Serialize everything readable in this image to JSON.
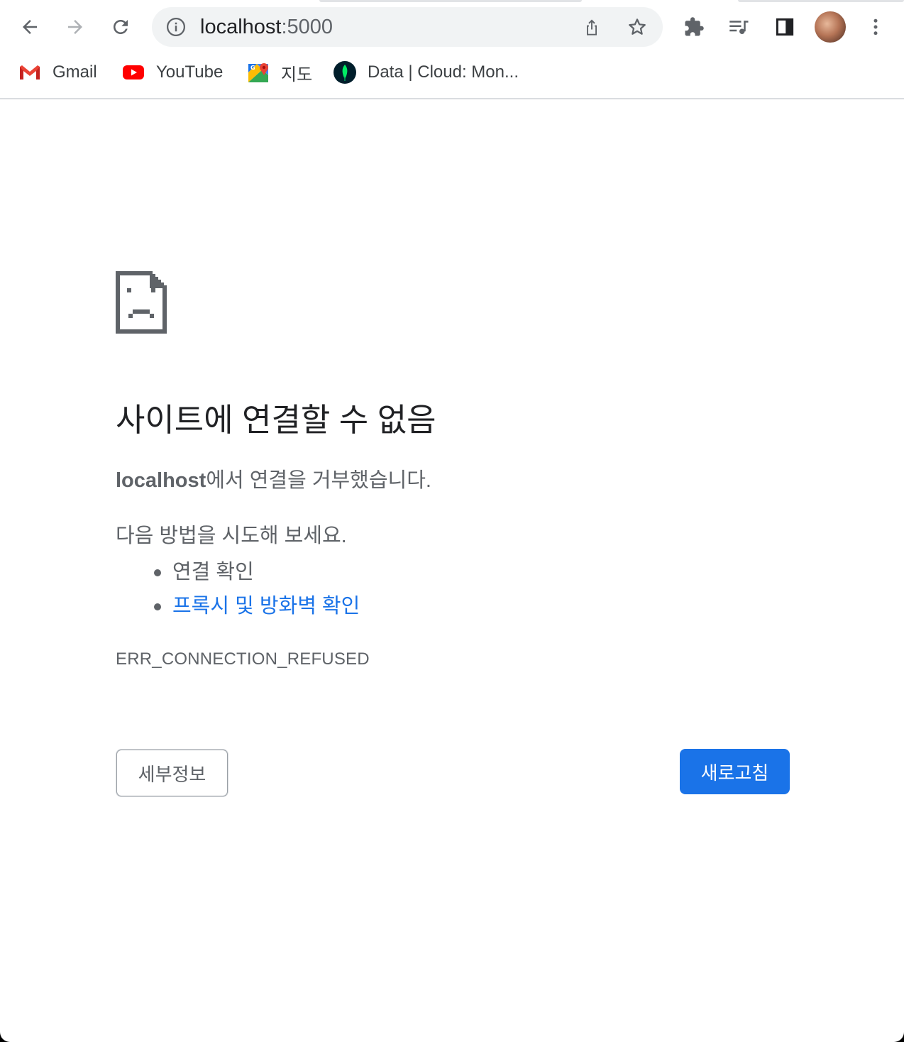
{
  "toolbar": {
    "back_icon": "arrow-left-icon",
    "forward_icon": "arrow-right-icon",
    "reload_icon": "reload-icon",
    "extensions_icon": "puzzle-icon",
    "media_icon": "media-playlist-icon",
    "side_panel_icon": "side-panel-icon",
    "menu_icon": "kebab-menu-icon"
  },
  "omnibox": {
    "info_icon": "info-icon",
    "host": "localhost",
    "port": ":5000",
    "share_icon": "share-icon",
    "star_icon": "star-icon"
  },
  "bookmarks": [
    {
      "label": "Gmail",
      "icon": "gmail-icon"
    },
    {
      "label": "YouTube",
      "icon": "youtube-icon"
    },
    {
      "label": "지도",
      "icon": "maps-icon"
    },
    {
      "label": "Data | Cloud: Mon...",
      "icon": "mongodb-leaf-icon"
    }
  ],
  "error": {
    "icon": "sad-page-icon",
    "title": "사이트에 연결할 수 없음",
    "host": "localhost",
    "description_suffix": "에서 연결을 거부했습니다.",
    "suggestions_intro": "다음 방법을 시도해 보세요.",
    "suggestions": [
      {
        "text": "연결 확인",
        "link": false
      },
      {
        "text": "프록시 및 방화벽 확인",
        "link": true
      }
    ],
    "code": "ERR_CONNECTION_REFUSED",
    "details_button": "세부정보",
    "reload_button": "새로고침"
  },
  "colors": {
    "link": "#1a73e8",
    "primary_button": "#1a73e8",
    "text_secondary": "#5f6368",
    "text_primary": "#202124"
  }
}
